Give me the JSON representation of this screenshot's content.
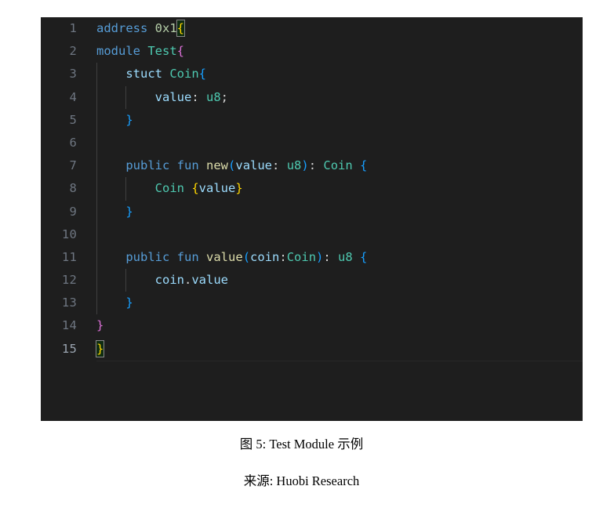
{
  "figure": {
    "caption": "图 5: Test Module 示例",
    "source": "来源: Huobi Research"
  },
  "editor": {
    "background_color": "#1e1e1e",
    "gutter_color": "#6e7681",
    "active_line_number_color": "#9aa4b0",
    "total_lines": 15,
    "language": "move",
    "line_numbers": [
      "1",
      "2",
      "3",
      "4",
      "5",
      "6",
      "7",
      "8",
      "9",
      "10",
      "11",
      "12",
      "13",
      "14",
      "15"
    ],
    "lines": [
      {
        "number": "1",
        "text": "address 0x1{"
      },
      {
        "number": "2",
        "text": "module Test{"
      },
      {
        "number": "3",
        "text": "    stuct Coin{"
      },
      {
        "number": "4",
        "text": "        value: u8;"
      },
      {
        "number": "5",
        "text": "    }"
      },
      {
        "number": "6",
        "text": ""
      },
      {
        "number": "7",
        "text": "    public fun new(value: u8): Coin {"
      },
      {
        "number": "8",
        "text": "        Coin {value}"
      },
      {
        "number": "9",
        "text": "    }"
      },
      {
        "number": "10",
        "text": ""
      },
      {
        "number": "11",
        "text": "    public fun value(coin:Coin): u8 {"
      },
      {
        "number": "12",
        "text": "        coin.value"
      },
      {
        "number": "13",
        "text": "    }"
      },
      {
        "number": "14",
        "text": "}"
      },
      {
        "number": "15",
        "text": "}"
      }
    ],
    "tokens": {
      "l1_keyword": "address",
      "l1_number": "0x1",
      "l1_brace": "{",
      "l2_keyword": "module",
      "l2_type": "Test",
      "l2_brace": "{",
      "l3_keyword": "stuct",
      "l3_type": "Coin",
      "l3_brace": "{",
      "l4_var": "value",
      "l4_colon": ": ",
      "l4_prim": "u8",
      "l4_semi": ";",
      "l5_brace": "}",
      "l7_kw_public": "public",
      "l7_kw_fun": "fun",
      "l7_fn": "new",
      "l7_paren_open": "(",
      "l7_param": "value",
      "l7_colon": ": ",
      "l7_prim": "u8",
      "l7_paren_close": ")",
      "l7_ret_colon": ": ",
      "l7_ret_type": "Coin",
      "l7_brace": " {",
      "l8_type": "Coin",
      "l8_brace_open": "{",
      "l8_var": "value",
      "l8_brace_close": "}",
      "l9_brace": "}",
      "l11_kw_public": "public",
      "l11_kw_fun": "fun",
      "l11_fn": "value",
      "l11_paren_open": "(",
      "l11_param": "coin",
      "l11_colon": ":",
      "l11_type": "Coin",
      "l11_paren_close": ")",
      "l11_ret_colon": ": ",
      "l11_prim": "u8",
      "l11_brace": " {",
      "l12_var": "coin",
      "l12_dot": ".",
      "l12_prop": "value",
      "l13_brace": "}",
      "l14_brace": "}",
      "l15_brace": "}"
    },
    "colors": {
      "keyword": "#569cd6",
      "type": "#4ec9b0",
      "number": "#b5cea8",
      "variable": "#9cdcfe",
      "function": "#dcdcaa",
      "punctuation": "#d4d4d4",
      "bracket_level1": "#ffd700",
      "bracket_level2": "#da70d6",
      "bracket_level3": "#179fff",
      "indent_guide": "#404040"
    }
  }
}
